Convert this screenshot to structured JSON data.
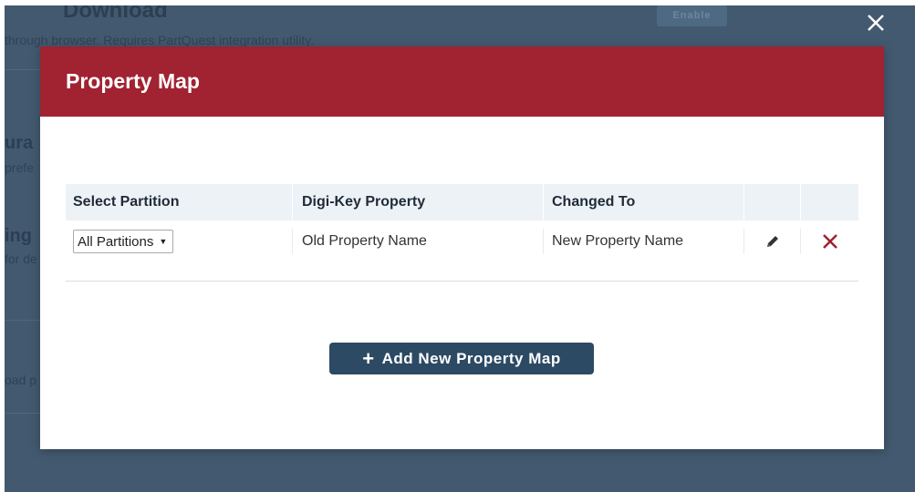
{
  "background": {
    "title": "Download",
    "description": "through browser. Requires PartQuest integration utility.",
    "enable_label": "Enable",
    "fragments": [
      "ura",
      "prefe",
      "ing",
      "for de",
      "oad p"
    ]
  },
  "modal": {
    "title": "Property Map",
    "table": {
      "headers": [
        "Select Partition",
        "Digi-Key Property",
        "Changed To"
      ],
      "rows": [
        {
          "partition": "All Partitions",
          "digikey_property": "Old Property Name",
          "changed_to": "New Property Name"
        }
      ]
    },
    "add_button_label": "Add New Property Map"
  },
  "icons": {
    "close": "close-icon",
    "edit": "pencil-icon",
    "delete": "delete-x-icon",
    "add": "plus-icon",
    "dropdown": "triangle-down-icon"
  },
  "colors": {
    "header_bg": "#a12231",
    "button_bg": "#2c4a63",
    "overlay_bg": "#42596f",
    "delete_icon": "#a12231"
  }
}
